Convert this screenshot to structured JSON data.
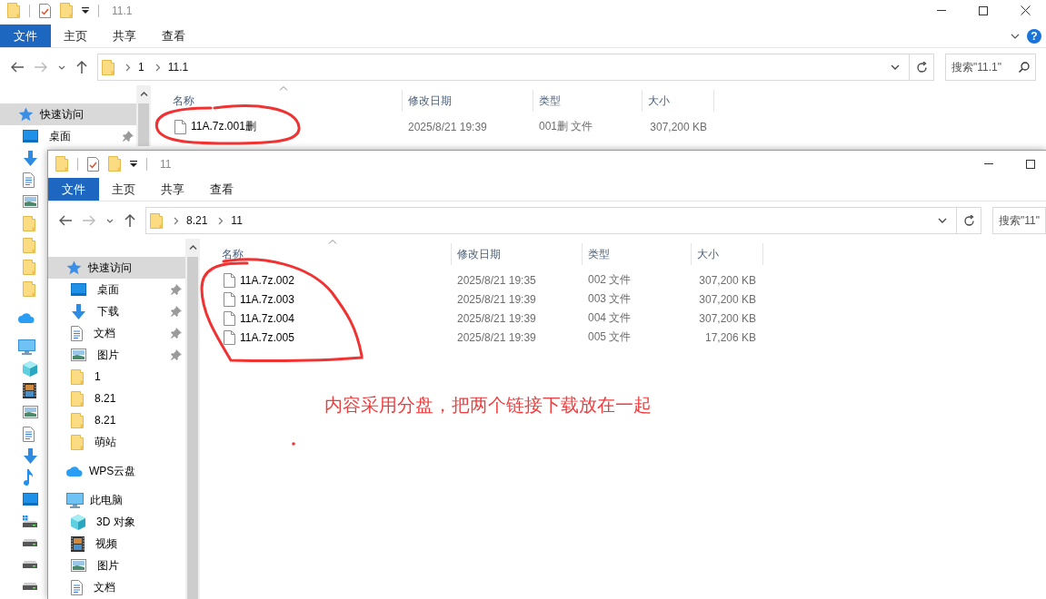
{
  "windows": [
    {
      "title": "11.1",
      "controls": [
        {
          "kind": "minimize"
        },
        {
          "kind": "maximize"
        },
        {
          "kind": "close"
        }
      ],
      "ribbon_tabs": [
        {
          "label": "文件",
          "kind": "menu"
        },
        {
          "label": "主页",
          "kind": "tab"
        },
        {
          "label": "共享",
          "kind": "tab"
        },
        {
          "label": "查看",
          "kind": "tab"
        }
      ],
      "help_label": "?",
      "path": [
        "1",
        "11.1"
      ],
      "search": {
        "placeholder": "搜索\"11.1\"",
        "icon": true
      },
      "columns": [
        "名称",
        "修改日期",
        "类型",
        "大小"
      ],
      "nav": [
        {
          "label": "快速访问",
          "kind": "star",
          "selected": true,
          "children": [
            {
              "label": "桌面",
              "kind": "desktop",
              "selected": false,
              "pinned": true
            },
            {
              "kind": "download",
              "selected": false,
              "pinned": false
            },
            {
              "kind": "document",
              "selected": false,
              "pinned": false
            },
            {
              "kind": "picture",
              "selected": false,
              "pinned": false
            },
            {
              "kind": "folder",
              "selected": false,
              "pinned": false
            },
            {
              "kind": "folder",
              "selected": false,
              "pinned": false
            },
            {
              "kind": "folder",
              "selected": false,
              "pinned": false
            },
            {
              "kind": "folder",
              "selected": false,
              "pinned": false
            }
          ]
        },
        {
          "kind": "cloud",
          "selected": false
        },
        {
          "kind": "pc",
          "selected": false,
          "children": [
            {
              "kind": "cube",
              "selected": false,
              "pinned": false
            },
            {
              "kind": "video",
              "selected": false,
              "pinned": false
            },
            {
              "kind": "picture",
              "selected": false,
              "pinned": false
            },
            {
              "kind": "document",
              "selected": false,
              "pinned": false
            },
            {
              "kind": "download",
              "selected": false,
              "pinned": false
            },
            {
              "kind": "music",
              "selected": false,
              "pinned": false
            },
            {
              "kind": "desktop",
              "selected": false,
              "pinned": false
            },
            {
              "kind": "drive-win",
              "selected": false,
              "pinned": false
            },
            {
              "kind": "drive",
              "selected": false,
              "pinned": false
            },
            {
              "kind": "drive",
              "selected": false,
              "pinned": false
            },
            {
              "kind": "drive",
              "selected": false,
              "pinned": false
            }
          ]
        }
      ],
      "files": [
        {
          "name": "11A.7z.001删",
          "modified": "2025/8/21 19:39",
          "type": "001删 文件",
          "size": "307,200 KB"
        }
      ]
    },
    {
      "title": "11",
      "controls": [
        {
          "kind": "minimize"
        },
        {
          "kind": "maximize"
        }
      ],
      "ribbon_tabs": [
        {
          "label": "文件",
          "kind": "menu"
        },
        {
          "label": "主页",
          "kind": "tab"
        },
        {
          "label": "共享",
          "kind": "tab"
        },
        {
          "label": "查看",
          "kind": "tab"
        }
      ],
      "path": [
        "8.21",
        "11"
      ],
      "search": {
        "placeholder": "搜索\"11\"",
        "icon": false
      },
      "columns": [
        "名称",
        "修改日期",
        "类型",
        "大小"
      ],
      "nav": [
        {
          "label": "快速访问",
          "kind": "star",
          "selected": true,
          "children": [
            {
              "label": "桌面",
              "kind": "desktop",
              "selected": false,
              "pinned": true
            },
            {
              "label": "下载",
              "kind": "download",
              "selected": false,
              "pinned": true
            },
            {
              "label": "文档",
              "kind": "document",
              "selected": false,
              "pinned": true
            },
            {
              "label": "图片",
              "kind": "picture",
              "selected": false,
              "pinned": true
            },
            {
              "label": "1",
              "kind": "folder",
              "selected": false,
              "pinned": false
            },
            {
              "label": "8.21",
              "kind": "folder",
              "selected": false,
              "pinned": false
            },
            {
              "label": "8.21",
              "kind": "folder",
              "selected": false,
              "pinned": false
            },
            {
              "label": "萌站",
              "kind": "folder",
              "selected": false,
              "pinned": false
            }
          ]
        },
        {
          "label": "WPS云盘",
          "kind": "cloud",
          "selected": false
        },
        {
          "label": "此电脑",
          "kind": "pc",
          "selected": false,
          "children": [
            {
              "label": "3D 对象",
              "kind": "cube",
              "selected": false,
              "pinned": false
            },
            {
              "label": "视频",
              "kind": "video",
              "selected": false,
              "pinned": false
            },
            {
              "label": "图片",
              "kind": "picture",
              "selected": false,
              "pinned": false
            },
            {
              "label": "文档",
              "kind": "document",
              "selected": false,
              "pinned": false
            }
          ]
        }
      ],
      "files": [
        {
          "name": "11A.7z.002",
          "modified": "2025/8/21 19:35",
          "type": "002 文件",
          "size": "307,200 KB"
        },
        {
          "name": "11A.7z.003",
          "modified": "2025/8/21 19:39",
          "type": "003 文件",
          "size": "307,200 KB"
        },
        {
          "name": "11A.7z.004",
          "modified": "2025/8/21 19:39",
          "type": "004 文件",
          "size": "307,200 KB"
        },
        {
          "name": "11A.7z.005",
          "modified": "2025/8/21 19:39",
          "type": "005 文件",
          "size": "17,206 KB"
        }
      ]
    }
  ],
  "annotations": [
    {
      "kind": "circle"
    },
    {
      "kind": "circle"
    },
    {
      "kind": "text",
      "text": "内容采用分盘，把两个链接下载放在一起"
    },
    {
      "kind": "dot"
    }
  ]
}
